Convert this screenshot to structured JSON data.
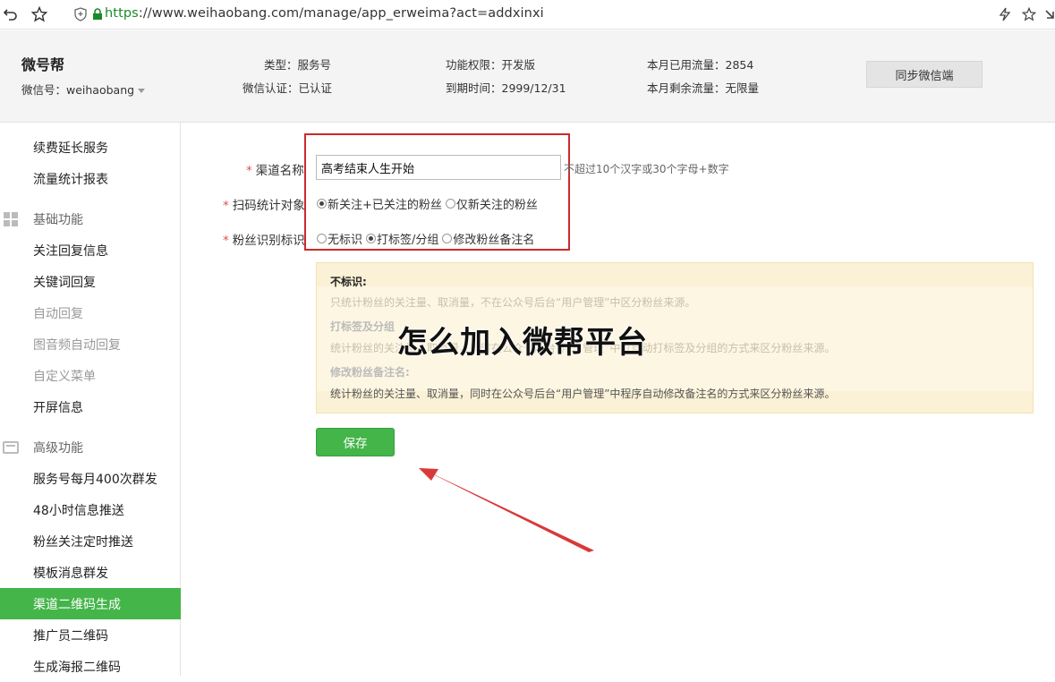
{
  "browser": {
    "url_scheme": "https",
    "url_rest": "://www.weihaobang.com/manage/app_erweima?act=addxinxi"
  },
  "header": {
    "brand": "微号帮",
    "wechat_id_label": "微信号：weihaobang",
    "type": "类型：服务号",
    "verify": "微信认证：已认证",
    "permission": "功能权限：开发版",
    "expire": "到期时间：2999/12/31",
    "used_traffic": "本月已用流量：2854",
    "remain_traffic": "本月剩余流量：无限量",
    "sync_button": "同步微信端"
  },
  "sidebar": {
    "items": [
      {
        "label": "续费延长服务"
      },
      {
        "label": "流量统计报表"
      },
      {
        "label": "基础功能"
      },
      {
        "label": "关注回复信息"
      },
      {
        "label": "关键词回复"
      },
      {
        "label": "自动回复"
      },
      {
        "label": "图音频自动回复"
      },
      {
        "label": "自定义菜单"
      },
      {
        "label": "开屏信息"
      },
      {
        "label": "高级功能"
      },
      {
        "label": "服务号每月400次群发"
      },
      {
        "label": "48小时信息推送"
      },
      {
        "label": "粉丝关注定时推送"
      },
      {
        "label": "模板消息群发"
      },
      {
        "label": "渠道二维码生成"
      },
      {
        "label": "推广员二维码"
      },
      {
        "label": "生成海报二维码"
      }
    ]
  },
  "form": {
    "channel_name_label": "渠道名称",
    "channel_name_value": "高考结束人生开始",
    "channel_name_hint": "不超过10个汉字或30个字母+数字",
    "scan_target_label": "扫码统计对象",
    "scan_target_options": [
      "新关注+已关注的粉丝",
      "仅新关注的粉丝"
    ],
    "fan_mark_label": "粉丝识别标识",
    "fan_mark_options": [
      "无标识",
      "打标签/分组",
      "修改粉丝备注名"
    ],
    "required_mark": "*"
  },
  "info": {
    "t1": "不标识:",
    "d1": "只统计粉丝的关注量、取消量，不在公众号后台“用户管理”中区分粉丝来源。",
    "t2": "打标签及分组",
    "d2": "统计粉丝的关注量、取消量，同时在公众号后台“用户管理”中以自动打标签及分组的方式来区分粉丝来源。",
    "t3": "修改粉丝备注名:",
    "d3": "统计粉丝的关注量、取消量，同时在公众号后台“用户管理”中程序自动修改备注名的方式来区分粉丝来源。"
  },
  "overlay": "怎么加入微帮平台",
  "save_button": "保存",
  "colors": {
    "accent": "#44b549",
    "highlight": "#cc2a2a"
  }
}
